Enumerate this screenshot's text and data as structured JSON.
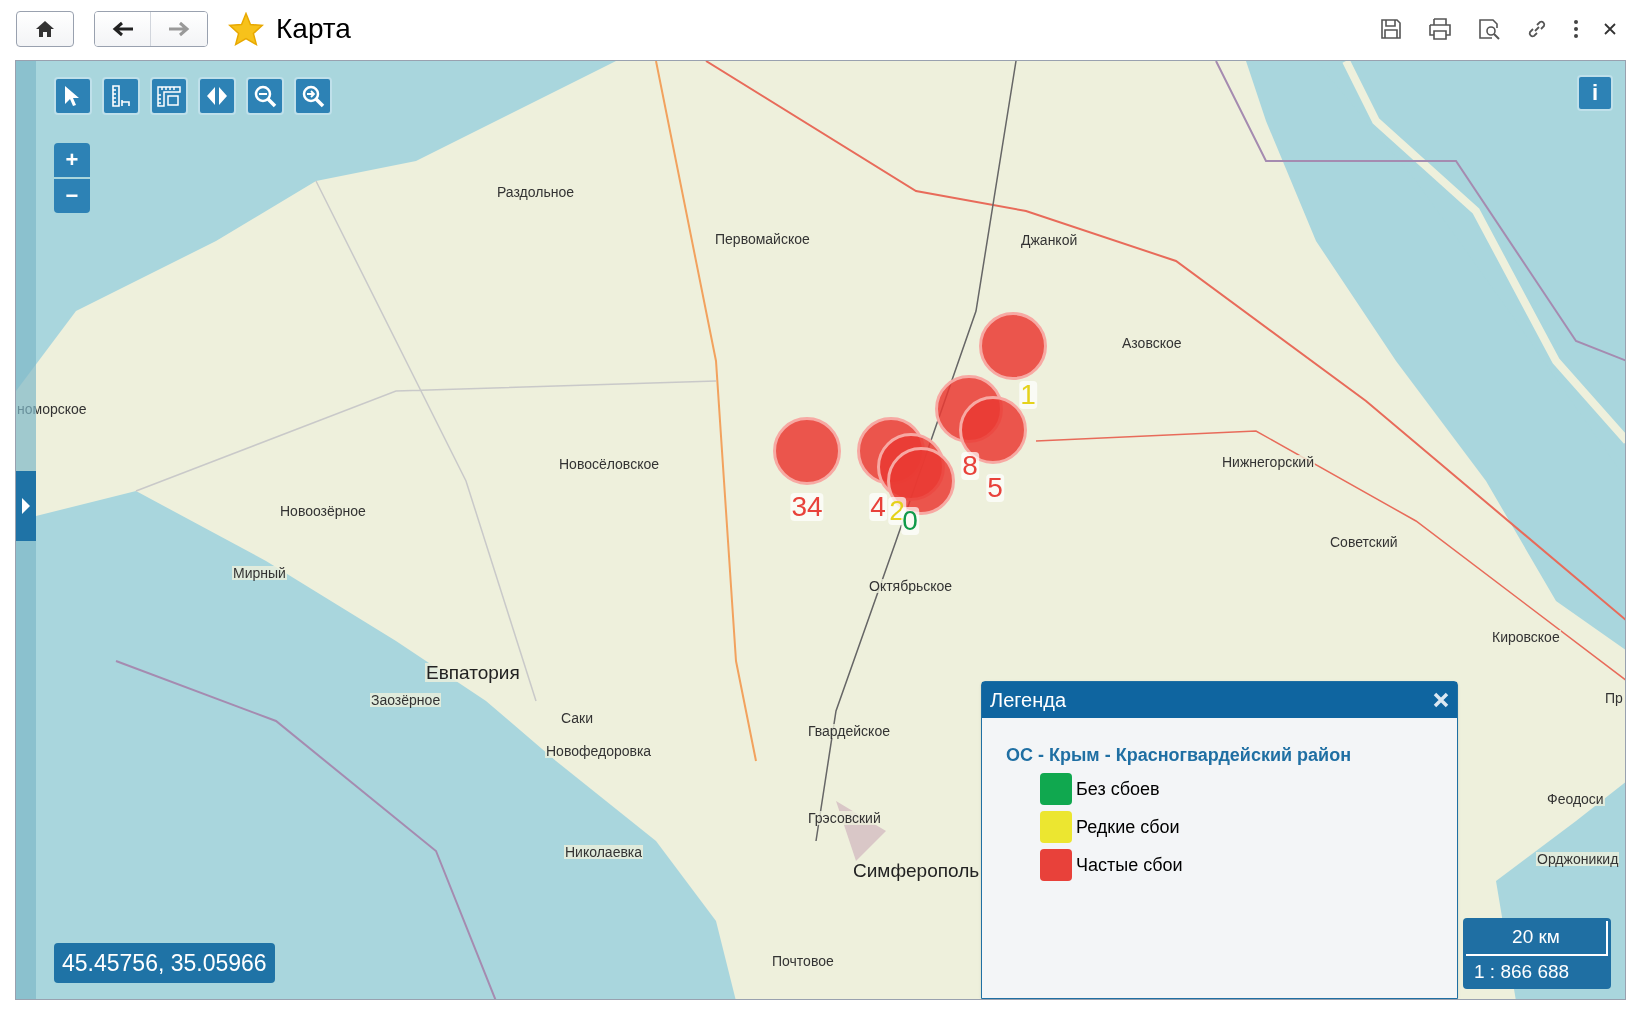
{
  "window": {
    "title": "Карта",
    "favorite": true
  },
  "map": {
    "info_button": "i",
    "zoom_in": "+",
    "zoom_out": "−",
    "places": [
      "Раздольное",
      "Первомайское",
      "Джанкой",
      "Азовское",
      "Новосёловское",
      "Новоозёрное",
      "Мирный",
      "Нижнегорский",
      "Советский",
      "Октябрьское",
      "Евпатория",
      "Заозёрное",
      "Саки",
      "Гвардейское",
      "Новофедоровка",
      "Кировское",
      "Грэсовский",
      "Николаевка",
      "Симферополь",
      "Почтовое",
      "номорское",
      "Пр",
      "Феодоси",
      "Орджоникид"
    ],
    "clusters": [
      {
        "count": "34",
        "color": "#e8413a"
      },
      {
        "count": "4",
        "color": "#e8413a"
      },
      {
        "count": "2",
        "color": "#e5d21a"
      },
      {
        "count": "0",
        "color": "#0f9a4a"
      },
      {
        "count": "8",
        "color": "#e8413a"
      },
      {
        "count": "5",
        "color": "#e8413a"
      },
      {
        "count": "1",
        "color": "#e5d21a"
      }
    ],
    "coordinates": "45.45756, 35.05966",
    "scale": {
      "distance": "20 км",
      "ratio": "1 : 866 688"
    }
  },
  "legend": {
    "title": "Легенда",
    "layer": "ОС - Крым - Красногвардейский район",
    "items": [
      {
        "label": "Без сбоев",
        "color": "#10a84f"
      },
      {
        "label": "Редкие сбои",
        "color": "#ece630"
      },
      {
        "label": "Частые сбои",
        "color": "#e8413a"
      }
    ]
  }
}
